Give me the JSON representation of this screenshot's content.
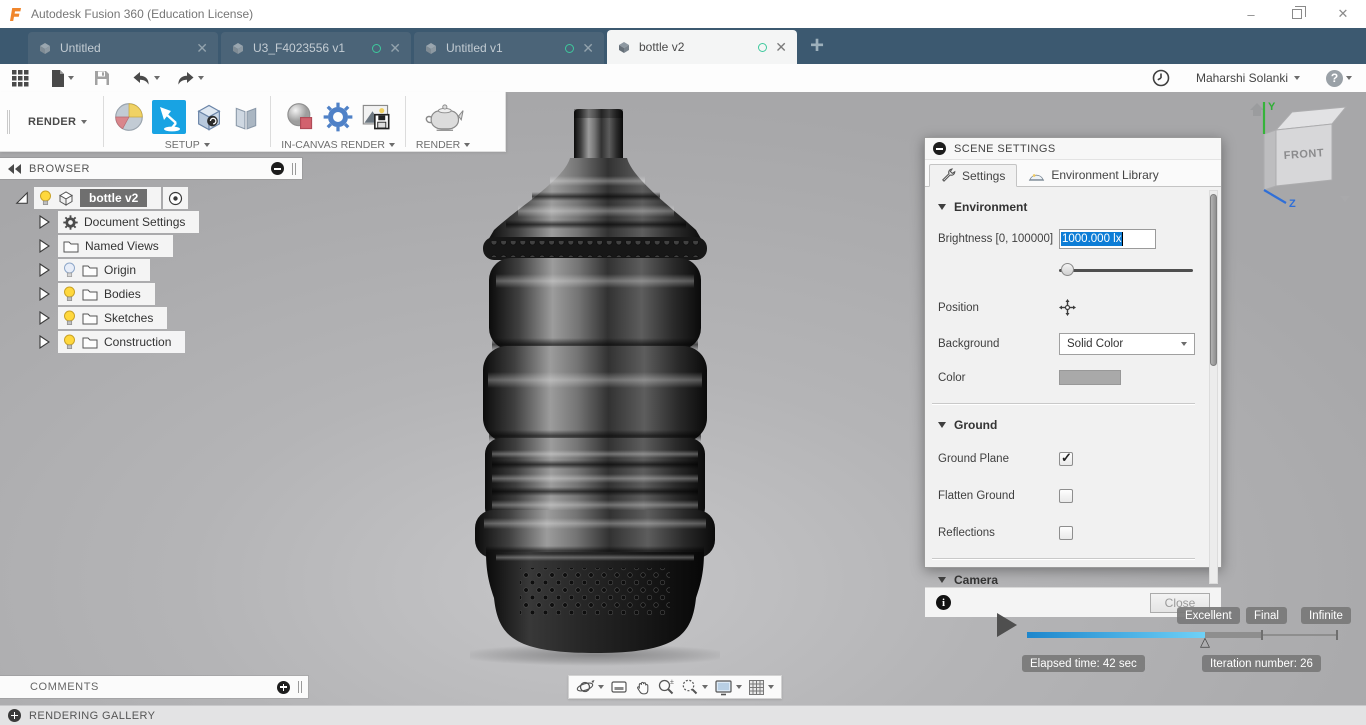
{
  "titlebar": {
    "title": "Autodesk Fusion 360 (Education License)"
  },
  "tabs": [
    {
      "label": "Untitled",
      "modified": false,
      "active": false
    },
    {
      "label": "U3_F4023556 v1",
      "modified": true,
      "active": false
    },
    {
      "label": "Untitled v1",
      "modified": true,
      "active": false
    },
    {
      "label": "bottle v2",
      "modified": true,
      "active": true
    }
  ],
  "header": {
    "user_name": "Maharshi Solanki"
  },
  "ribbon": {
    "workspace_label": "RENDER",
    "setup_label": "SETUP",
    "incanvas_label": "IN-CANVAS RENDER",
    "render_label": "RENDER"
  },
  "browser": {
    "title": "BROWSER",
    "root_label": "bottle v2",
    "items": [
      {
        "label": "Document Settings",
        "icon": "gear-icon",
        "bulb": null
      },
      {
        "label": "Named Views",
        "icon": "folder-icon",
        "bulb": null
      },
      {
        "label": "Origin",
        "icon": "folder-icon",
        "bulb": "off"
      },
      {
        "label": "Bodies",
        "icon": "folder-icon",
        "bulb": "on"
      },
      {
        "label": "Sketches",
        "icon": "folder-icon",
        "bulb": "on"
      },
      {
        "label": "Construction",
        "icon": "folder-icon",
        "bulb": "on"
      }
    ]
  },
  "scene_settings": {
    "title": "SCENE SETTINGS",
    "tabs": [
      {
        "label": "Settings",
        "active": true
      },
      {
        "label": "Environment Library",
        "active": false
      }
    ],
    "environment": {
      "title": "Environment",
      "brightness_label": "Brightness [0, 100000]",
      "brightness_value": "1000.000 lx",
      "position_label": "Position",
      "background_label": "Background",
      "background_value": "Solid Color",
      "color_label": "Color",
      "color_swatch": "#a9a9a9"
    },
    "ground": {
      "title": "Ground",
      "options": [
        {
          "label": "Ground Plane",
          "checked": true
        },
        {
          "label": "Flatten Ground",
          "checked": false
        },
        {
          "label": "Reflections",
          "checked": false
        }
      ]
    },
    "camera": {
      "title": "Camera"
    },
    "close_label": "Close"
  },
  "viewcube": {
    "face_label": "FRONT",
    "axis_y": "Y",
    "axis_z": "Z"
  },
  "render_controls": {
    "quality_excellent": "Excellent",
    "quality_final": "Final",
    "quality_infinite": "Infinite",
    "elapsed": "Elapsed time: 42 sec",
    "iteration": "Iteration number: 26"
  },
  "comments": {
    "title": "COMMENTS"
  },
  "statusbar": {
    "label": "RENDERING GALLERY"
  },
  "colors": {
    "accent_blue": "#18a3e3",
    "selection_blue": "#0d7dd6",
    "tabbar": "#3c5970",
    "progress_start": "#1d86cc",
    "progress_end": "#6fd1f7",
    "badge_gray": "#7b7b7b",
    "bulb_on": "#ffd83d"
  }
}
